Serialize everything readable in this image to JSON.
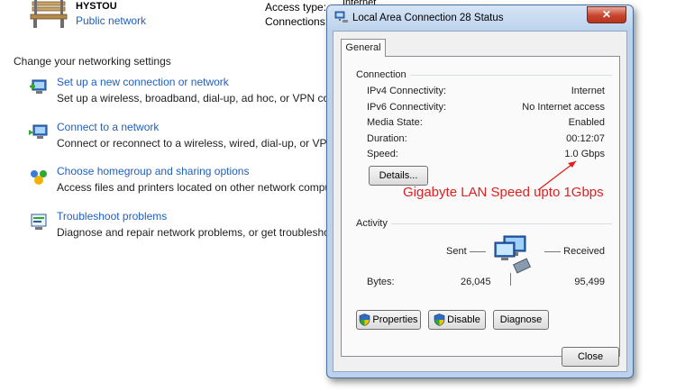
{
  "background": {
    "network_name": "HYSTOU",
    "network_type": "Public network",
    "access_type_label": "Access type:",
    "connections_label": "Connections:",
    "access_type_value": "Internet",
    "settings_title": "Change your networking settings",
    "tasks": [
      {
        "link": "Set up a new connection or network",
        "desc": "Set up a wireless, broadband, dial-up, ad hoc, or VPN connectio",
        "icon": "new-connection-icon"
      },
      {
        "link": "Connect to a network",
        "desc": "Connect or reconnect to a wireless, wired, dial-up, or VPN netw",
        "icon": "connect-network-icon"
      },
      {
        "link": "Choose homegroup and sharing options",
        "desc": "Access files and printers located on other network computers, o",
        "icon": "homegroup-icon"
      },
      {
        "link": "Troubleshoot problems",
        "desc": "Diagnose and repair network problems, or get troubleshooting i",
        "icon": "troubleshoot-icon"
      }
    ]
  },
  "dialog": {
    "title": "Local Area Connection 28 Status",
    "close_glyph": "✕",
    "tab": "General",
    "connection": {
      "title": "Connection",
      "rows": [
        {
          "label": "IPv4 Connectivity:",
          "value": "Internet"
        },
        {
          "label": "IPv6 Connectivity:",
          "value": "No Internet access"
        },
        {
          "label": "Media State:",
          "value": "Enabled"
        },
        {
          "label": "Duration:",
          "value": "00:12:07"
        },
        {
          "label": "Speed:",
          "value": "1.0 Gbps"
        }
      ],
      "details_button": "Details..."
    },
    "annotation": "Gigabyte LAN Speed upto 1Gbps",
    "activity": {
      "title": "Activity",
      "sent_label": "Sent",
      "received_label": "Received",
      "bytes_label": "Bytes:",
      "bytes_sent": "26,045",
      "bytes_received": "95,499"
    },
    "buttons": {
      "properties": "Properties",
      "disable": "Disable",
      "diagnose": "Diagnose",
      "close": "Close"
    }
  },
  "colors": {
    "link": "#1f5fbf",
    "annotation": "#e02020",
    "dialog_frame": "#bcd2ec"
  }
}
